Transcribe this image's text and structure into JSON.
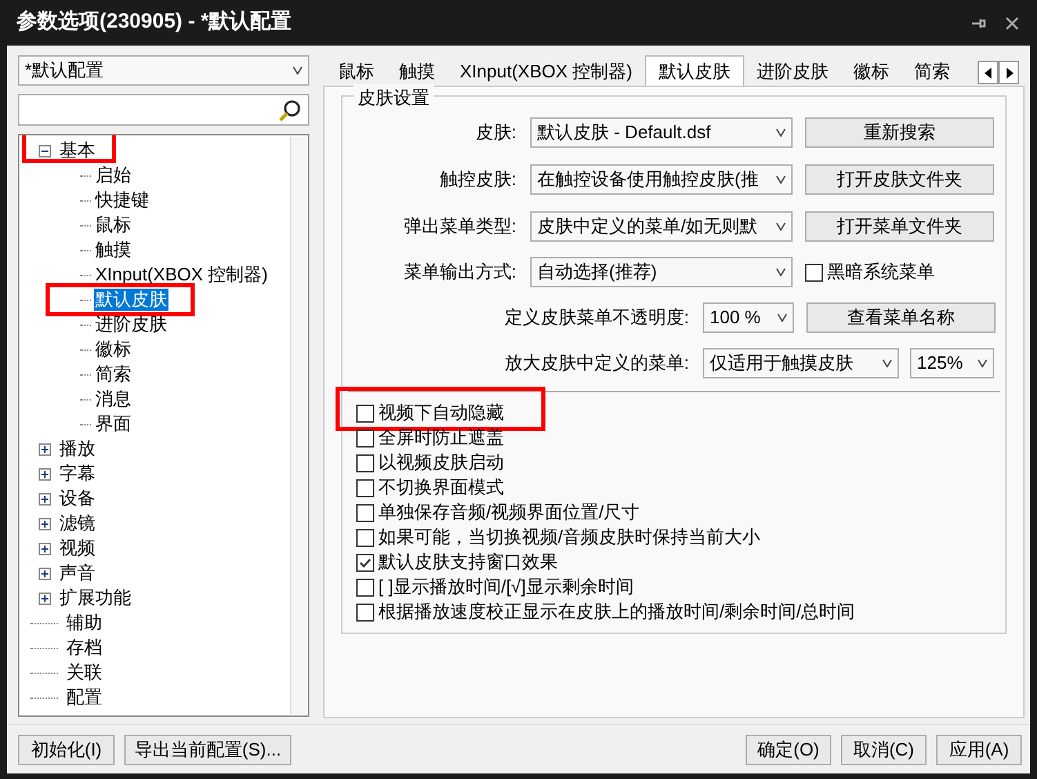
{
  "window": {
    "title": "参数选项(230905) - *默认配置"
  },
  "profile_select": {
    "value": "*默认配置"
  },
  "tree": [
    {
      "label": "基本",
      "expanded": true,
      "highlighted": true,
      "selected": false,
      "children": [
        {
          "label": "启始",
          "selected": false,
          "highlighted": false
        },
        {
          "label": "快捷键",
          "selected": false,
          "highlighted": false
        },
        {
          "label": "鼠标",
          "selected": false,
          "highlighted": false
        },
        {
          "label": "触摸",
          "selected": false,
          "highlighted": false
        },
        {
          "label": "XInput(XBOX 控制器)",
          "selected": false,
          "highlighted": false
        },
        {
          "label": "默认皮肤",
          "selected": true,
          "highlighted": true
        },
        {
          "label": "进阶皮肤",
          "selected": false,
          "highlighted": false
        },
        {
          "label": "徽标",
          "selected": false,
          "highlighted": false
        },
        {
          "label": "简索",
          "selected": false,
          "highlighted": false
        },
        {
          "label": "消息",
          "selected": false,
          "highlighted": false
        },
        {
          "label": "界面",
          "selected": false,
          "highlighted": false
        }
      ]
    },
    {
      "label": "播放",
      "expanded": false,
      "highlighted": false,
      "selected": false
    },
    {
      "label": "字幕",
      "expanded": false,
      "highlighted": false,
      "selected": false
    },
    {
      "label": "设备",
      "expanded": false,
      "highlighted": false,
      "selected": false
    },
    {
      "label": "滤镜",
      "expanded": false,
      "highlighted": false,
      "selected": false
    },
    {
      "label": "视频",
      "expanded": false,
      "highlighted": false,
      "selected": false
    },
    {
      "label": "声音",
      "expanded": false,
      "highlighted": false,
      "selected": false
    },
    {
      "label": "扩展功能",
      "expanded": false,
      "highlighted": false,
      "selected": false
    },
    {
      "label": "辅助",
      "highlighted": false,
      "selected": false
    },
    {
      "label": "存档",
      "highlighted": false,
      "selected": false
    },
    {
      "label": "关联",
      "highlighted": false,
      "selected": false
    },
    {
      "label": "配置",
      "highlighted": false,
      "selected": false
    }
  ],
  "left_buttons": [
    "初始化(I)",
    "导出当前配置(S)..."
  ],
  "tabs": [
    {
      "label": "鼠标",
      "selected": false
    },
    {
      "label": "触摸",
      "selected": false
    },
    {
      "label": "XInput(XBOX 控制器)",
      "selected": false
    },
    {
      "label": "默认皮肤",
      "selected": true
    },
    {
      "label": "进阶皮肤",
      "selected": false
    },
    {
      "label": "徽标",
      "selected": false
    },
    {
      "label": "简索",
      "selected": false
    }
  ],
  "group": {
    "title": "皮肤设置",
    "rows": [
      {
        "kind": "wide",
        "label": "皮肤:",
        "select": "默认皮肤 - Default.dsf",
        "extra": {
          "kind": "button",
          "label": "重新搜索"
        }
      },
      {
        "kind": "wide",
        "label": "触控皮肤:",
        "select": "在触控设备使用触控皮肤(推",
        "extra": {
          "kind": "button",
          "label": "打开皮肤文件夹"
        }
      },
      {
        "kind": "wide",
        "label": "弹出菜单类型:",
        "select": "皮肤中定义的菜单/如无则默",
        "extra": {
          "kind": "button",
          "label": "打开菜单文件夹"
        }
      },
      {
        "kind": "wide",
        "label": "菜单输出方式:",
        "select": "自动选择(推荐)",
        "extra": {
          "kind": "checkbox",
          "label": "黑暗系统菜单",
          "checked": false
        }
      },
      {
        "kind": "narrow",
        "label": "定义皮肤菜单不透明度:",
        "select": "100 %",
        "extra": {
          "kind": "button",
          "label": "查看菜单名称"
        }
      },
      {
        "kind": "narrow_wide",
        "label": "放大皮肤中定义的菜单:",
        "select": "仅适用于触摸皮肤",
        "extra": {
          "kind": "select",
          "label": "125%"
        }
      }
    ]
  },
  "options": [
    {
      "label": "视频下自动隐藏",
      "checked": false,
      "highlighted": true
    },
    {
      "label": "全屏时防止遮盖",
      "checked": false,
      "highlighted": false
    },
    {
      "label": "以视频皮肤启动",
      "checked": false,
      "highlighted": false
    },
    {
      "label": "不切换界面模式",
      "checked": false,
      "highlighted": false
    },
    {
      "label": "单独保存音频/视频界面位置/尺寸",
      "checked": false,
      "highlighted": false
    },
    {
      "label": "如果可能，当切换视频/音频皮肤时保持当前大小",
      "checked": false,
      "highlighted": false
    },
    {
      "label": "默认皮肤支持窗口效果",
      "checked": true,
      "highlighted": false
    },
    {
      "label": "[  ]显示播放时间/[√]显示剩余时间",
      "checked": false,
      "highlighted": false
    },
    {
      "label": "根据播放速度校正显示在皮肤上的播放时间/剩余时间/总时间",
      "checked": false,
      "highlighted": false
    }
  ],
  "dialog_buttons": [
    "确定(O)",
    "取消(C)",
    "应用(A)"
  ]
}
